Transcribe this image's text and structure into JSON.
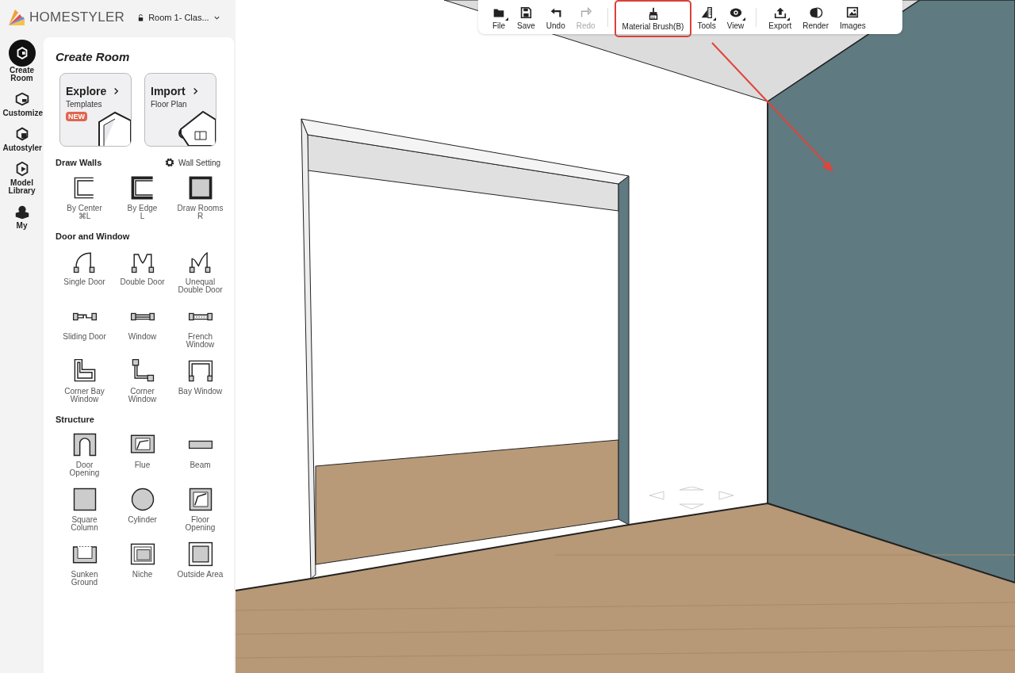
{
  "header": {
    "logo": "HOMESTYLER",
    "project": "Room 1- Clas..."
  },
  "rail": [
    {
      "label": "Create Room",
      "selected": true
    },
    {
      "label": "Customize",
      "selected": false
    },
    {
      "label": "Autostyler",
      "selected": false
    },
    {
      "label": "Model Library",
      "selected": false
    },
    {
      "label": "My",
      "selected": false
    }
  ],
  "panel": {
    "title": "Create Room",
    "cards": [
      {
        "title": "Explore",
        "subtitle": "Templates",
        "badge": "NEW"
      },
      {
        "title": "Import",
        "subtitle": "Floor Plan"
      }
    ],
    "sections": [
      {
        "title": "Draw Walls",
        "action": "Wall Setting",
        "items": [
          {
            "label": "By Center",
            "shortcut": "⌘L"
          },
          {
            "label": "By Edge",
            "shortcut": "L"
          },
          {
            "label": "Draw Rooms",
            "shortcut": "R"
          }
        ]
      },
      {
        "title": "Door and Window",
        "items": [
          {
            "label": "Single Door"
          },
          {
            "label": "Double Door"
          },
          {
            "label": "Unequal Double Door"
          },
          {
            "label": "Sliding Door"
          },
          {
            "label": "Window"
          },
          {
            "label": "French Window"
          },
          {
            "label": "Corner Bay Window"
          },
          {
            "label": "Corner Window"
          },
          {
            "label": "Bay Window"
          }
        ]
      },
      {
        "title": "Structure",
        "items": [
          {
            "label": "Door Opening"
          },
          {
            "label": "Flue"
          },
          {
            "label": "Beam"
          },
          {
            "label": "Square Column"
          },
          {
            "label": "Cylinder"
          },
          {
            "label": "Floor Opening"
          },
          {
            "label": "Sunken Ground"
          },
          {
            "label": "Niche"
          },
          {
            "label": "Outside Area"
          }
        ]
      }
    ]
  },
  "toolbar": {
    "groups": [
      [
        {
          "label": "File",
          "menu": true,
          "disabled": false,
          "highlighted": false
        },
        {
          "label": "Save",
          "menu": false,
          "disabled": false,
          "highlighted": false
        },
        {
          "label": "Undo",
          "menu": false,
          "disabled": false,
          "highlighted": false
        },
        {
          "label": "Redo",
          "menu": false,
          "disabled": true,
          "highlighted": false
        }
      ],
      [
        {
          "label": "Material Brush(B)",
          "menu": false,
          "disabled": false,
          "highlighted": true
        },
        {
          "label": "Tools",
          "menu": true,
          "disabled": false,
          "highlighted": false
        },
        {
          "label": "View",
          "menu": true,
          "disabled": false,
          "highlighted": false
        }
      ],
      [
        {
          "label": "Export",
          "menu": true,
          "disabled": false,
          "highlighted": false
        },
        {
          "label": "Render",
          "menu": false,
          "disabled": false,
          "highlighted": false
        },
        {
          "label": "Images",
          "menu": false,
          "disabled": false,
          "highlighted": false
        }
      ]
    ]
  }
}
